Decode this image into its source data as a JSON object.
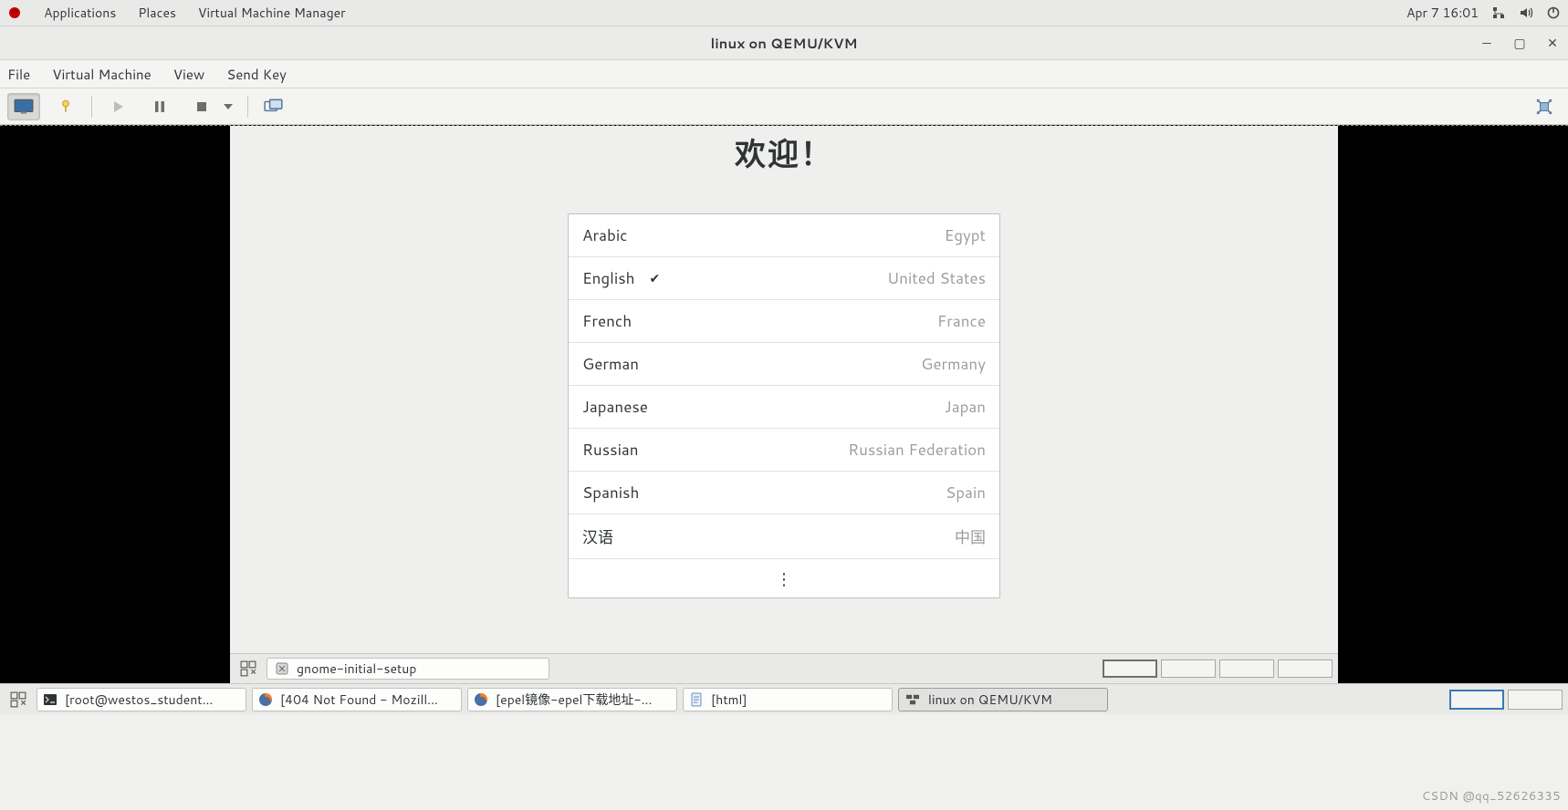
{
  "host_panel": {
    "menus": {
      "applications": "Applications",
      "places": "Places",
      "app": "Virtual Machine Manager"
    },
    "clock": "Apr 7  16:01"
  },
  "vmm": {
    "title": "linux on QEMU/KVM",
    "menus": {
      "file": "File",
      "vm": "Virtual Machine",
      "view": "View",
      "sendkey": "Send Key"
    }
  },
  "guest": {
    "welcome": "欢迎！",
    "languages": [
      {
        "name": "Arabic",
        "region": "Egypt",
        "selected": false
      },
      {
        "name": "English",
        "region": "United States",
        "selected": true
      },
      {
        "name": "French",
        "region": "France",
        "selected": false
      },
      {
        "name": "German",
        "region": "Germany",
        "selected": false
      },
      {
        "name": "Japanese",
        "region": "Japan",
        "selected": false
      },
      {
        "name": "Russian",
        "region": "Russian Federation",
        "selected": false
      },
      {
        "name": "Spanish",
        "region": "Spain",
        "selected": false
      },
      {
        "name": "汉语",
        "region": "中国",
        "selected": false
      }
    ],
    "more_glyph": "⋮",
    "taskbar_app": "gnome-initial-setup"
  },
  "host_taskbar": {
    "tasks": [
      {
        "label": "[root@westos_student...",
        "icon": "terminal"
      },
      {
        "label": "[404 Not Found - Mozill...",
        "icon": "firefox"
      },
      {
        "label": "[epel镜像-epel下载地址-...",
        "icon": "firefox"
      },
      {
        "label": "[html]",
        "icon": "text"
      },
      {
        "label": "linux on QEMU/KVM",
        "icon": "vmm",
        "active": true
      }
    ]
  },
  "watermark": "CSDN @qq_52626335"
}
